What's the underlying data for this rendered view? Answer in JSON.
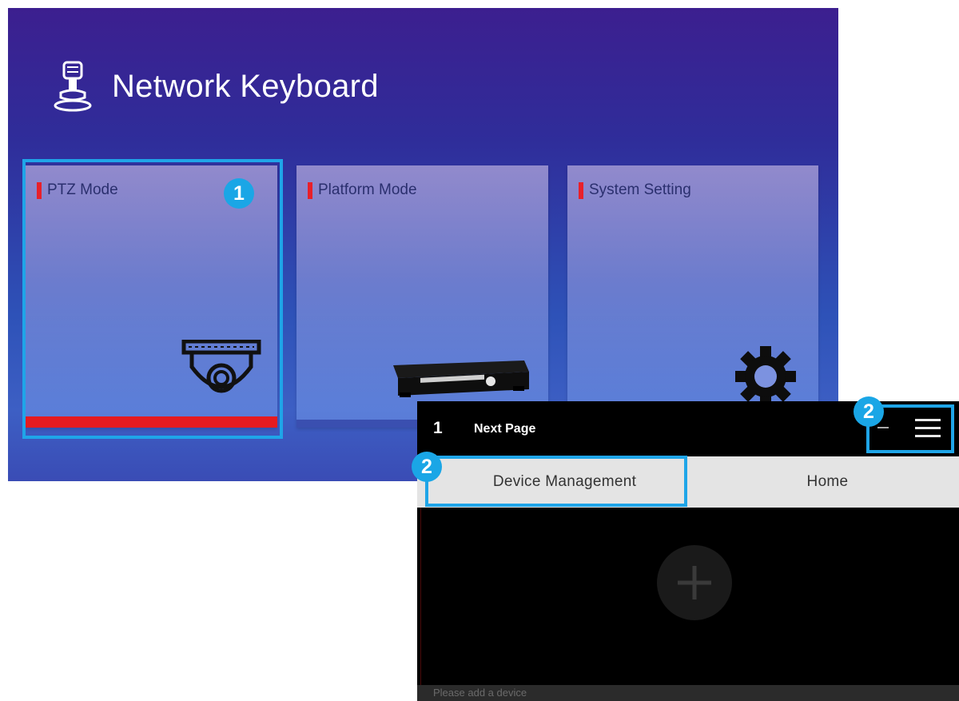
{
  "app": {
    "title": "Network Keyboard",
    "icon": "ptz-camera-icon"
  },
  "modes": [
    {
      "label": "PTZ Mode",
      "icon": "dome-camera-icon",
      "selected": true
    },
    {
      "label": "Platform Mode",
      "icon": "nvr-device-icon",
      "selected": false
    },
    {
      "label": "System Setting",
      "icon": "gear-icon",
      "selected": false
    }
  ],
  "callouts": {
    "step1": "1",
    "step2_menu": "2",
    "step2_tab": "2"
  },
  "phone": {
    "page_number": "1",
    "next_page": "Next Page",
    "menu_icon": "hamburger-menu-icon",
    "tabs": [
      {
        "label": "Device Management",
        "active": true
      },
      {
        "label": "Home",
        "active": false
      }
    ],
    "add_icon": "plus-icon",
    "status_text": "Please add a device"
  },
  "colors": {
    "highlight": "#1fa5e8",
    "accent_red": "#e51b20",
    "badge": "#1aa6e6"
  }
}
